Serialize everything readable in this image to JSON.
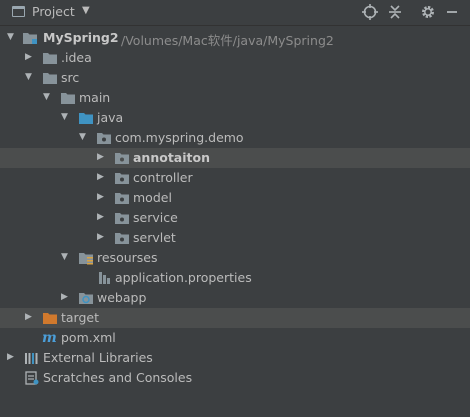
{
  "header": {
    "title": "Project",
    "buttons": [
      "locate-icon",
      "collapse-all-icon",
      "gear-icon",
      "hide-icon"
    ]
  },
  "tree": [
    {
      "name": "root-module",
      "label": "MySpring2",
      "path": "/Volumes/Mac软件/java/MySpring2",
      "expanded": true,
      "icon": "module-folder-icon"
    },
    {
      "name": "idea-folder",
      "label": ".idea",
      "expanded": false,
      "icon": "folder-icon"
    },
    {
      "name": "src-folder",
      "label": "src",
      "expanded": true,
      "icon": "folder-icon"
    },
    {
      "name": "main-folder",
      "label": "main",
      "expanded": true,
      "icon": "folder-icon"
    },
    {
      "name": "java-folder",
      "label": "java",
      "expanded": true,
      "icon": "source-folder-icon"
    },
    {
      "name": "package-demo",
      "label": "com.myspring.demo",
      "expanded": true,
      "icon": "package-icon"
    },
    {
      "name": "package-annotaiton",
      "label": "annotaiton",
      "expanded": false,
      "icon": "package-icon"
    },
    {
      "name": "package-controller",
      "label": "controller",
      "expanded": false,
      "icon": "package-icon"
    },
    {
      "name": "package-model",
      "label": "model",
      "expanded": false,
      "icon": "package-icon"
    },
    {
      "name": "package-service",
      "label": "service",
      "expanded": false,
      "icon": "package-icon"
    },
    {
      "name": "package-servlet",
      "label": "servlet",
      "expanded": false,
      "icon": "package-icon"
    },
    {
      "name": "resourses-folder",
      "label": "resourses",
      "expanded": true,
      "icon": "resources-folder-icon"
    },
    {
      "name": "application-properties",
      "label": "application.properties",
      "icon": "properties-file-icon"
    },
    {
      "name": "webapp-folder",
      "label": "webapp",
      "expanded": false,
      "icon": "web-folder-icon"
    },
    {
      "name": "target-folder",
      "label": "target",
      "expanded": false,
      "icon": "excluded-folder-icon"
    },
    {
      "name": "pom-xml",
      "label": "pom.xml",
      "icon": "maven-file-icon"
    },
    {
      "name": "external-libraries",
      "label": "External Libraries",
      "expanded": false,
      "icon": "libraries-icon"
    },
    {
      "name": "scratches-and-consoles",
      "label": "Scratches and Consoles",
      "icon": "scratches-icon"
    }
  ],
  "colors": {
    "background": "#3c3f41",
    "selection": "#4b4d4d",
    "folder": "#87939a",
    "source_folder": "#3f93c2",
    "excluded_folder": "#d0792d",
    "maven": "#4b9ed8"
  }
}
